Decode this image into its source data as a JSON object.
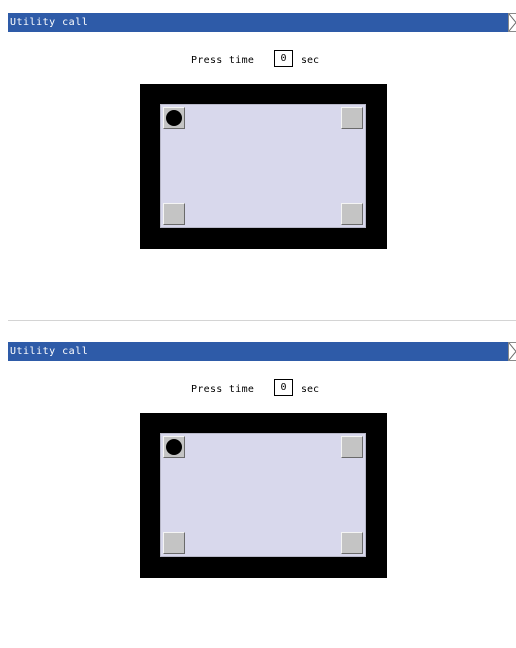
{
  "screens": [
    {
      "title": "Utility call",
      "close_icon": "close-x-icon",
      "press_time": {
        "label": "Press time",
        "value": "0",
        "unit": "sec"
      },
      "active_corner": "top-left",
      "active_marker_icon": "filled-circle-icon"
    },
    {
      "title": "Utility call",
      "close_icon": "close-x-icon",
      "press_time": {
        "label": "Press time",
        "value": "0",
        "unit": "sec"
      },
      "active_corner": "top-left",
      "active_marker_icon": "filled-circle-icon"
    }
  ],
  "colors": {
    "title_bar": "#2e5ba8",
    "title_text": "#ffffff",
    "frame": "#000000",
    "screen_area": "#d8d8ec",
    "corner_button": "#c4c4c4"
  }
}
